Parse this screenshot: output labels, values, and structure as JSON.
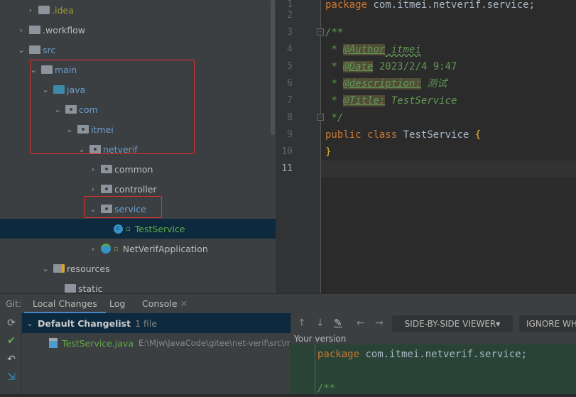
{
  "tree": {
    "items": [
      {
        "label": ".idea",
        "expanded": false
      },
      {
        "label": ".workflow",
        "expanded": false
      },
      {
        "label": "src",
        "expanded": true
      },
      {
        "label": "main",
        "expanded": true
      },
      {
        "label": "java",
        "expanded": true
      },
      {
        "label": "com",
        "expanded": true
      },
      {
        "label": "itmei",
        "expanded": true
      },
      {
        "label": "netverif",
        "expanded": true
      },
      {
        "label": "common",
        "expanded": false
      },
      {
        "label": "controller",
        "expanded": false
      },
      {
        "label": "service",
        "expanded": true
      },
      {
        "label": "TestService",
        "selected": true
      },
      {
        "label": "NetVerifApplication",
        "expanded": false
      },
      {
        "label": "resources",
        "expanded": true
      },
      {
        "label": "static"
      }
    ]
  },
  "editor": {
    "line_numbers": [
      "1",
      "2",
      "3",
      "4",
      "5",
      "6",
      "7",
      "8",
      "9",
      "10",
      "11"
    ],
    "line1": {
      "kw": "package",
      "rest": " com.itmei.netverif.service;"
    },
    "line3": "/**",
    "line4": {
      "star": " * ",
      "tag": "@Author",
      "val": " itmei"
    },
    "line5": {
      "star": " * ",
      "tag": "@Date",
      "val": " 2023/2/4 9:47"
    },
    "line6": {
      "star": " * ",
      "tag": "@description:",
      "val": " 测试"
    },
    "line7": {
      "star": " * ",
      "tag": "@Title:",
      "val": " TestService"
    },
    "line8": " */",
    "line9": {
      "kw1": "public",
      "kw2": "class",
      "name": "TestService",
      "brace": "{"
    },
    "line10": "}"
  },
  "bottom": {
    "git_label": "Git:",
    "tabs": [
      "Local Changes",
      "Log",
      "Console"
    ],
    "active_tab": "Local Changes",
    "changelist": {
      "name": "Default Changelist",
      "count": "1 file"
    },
    "file": {
      "name": "TestService.java",
      "path": "E:\\Mjw\\JavaCode\\gitee\\net-verif\\src\\m"
    },
    "diff": {
      "viewer": "SIDE-BY-SIDE VIEWER",
      "ignore": "IGNORE WH",
      "your_version": "Your version",
      "code_kw": "package",
      "code_rest": " com.itmei.netverif.service;",
      "code3": "/**"
    }
  },
  "colors": {
    "selection": "#0d293e",
    "accent": "#4a88c7",
    "highlight_box": "#e0302b",
    "added_bg": "#294436"
  }
}
